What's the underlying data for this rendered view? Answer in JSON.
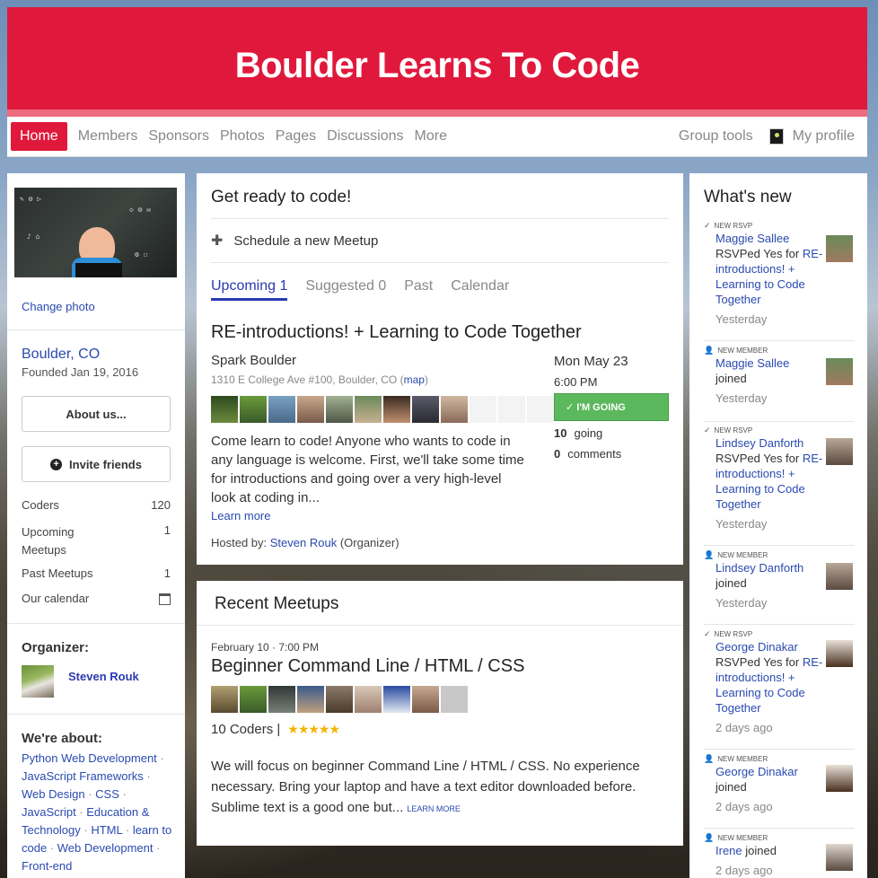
{
  "group_name": "Boulder Learns To Code",
  "nav": {
    "home": "Home",
    "members": "Members",
    "sponsors": "Sponsors",
    "photos": "Photos",
    "pages": "Pages",
    "discussions": "Discussions",
    "more": "More",
    "group_tools": "Group tools",
    "my_profile": "My profile"
  },
  "sidebar": {
    "change_photo": "Change photo",
    "location": "Boulder, CO",
    "founded": "Founded Jan 19, 2016",
    "about_button": "About us...",
    "invite_button": "Invite friends",
    "stats": [
      {
        "label": "Coders",
        "value": "120"
      },
      {
        "label": "Upcoming Meetups",
        "value": "1"
      },
      {
        "label": "Past Meetups",
        "value": "1"
      },
      {
        "label": "Our calendar",
        "value": ""
      }
    ],
    "organizer_label": "Organizer:",
    "organizer_name": "Steven Rouk",
    "about_label": "We're about:",
    "topics": [
      "Python Web Development",
      "JavaScript Frameworks",
      "Web Design",
      "CSS",
      "JavaScript",
      "Education & Technology",
      "HTML",
      "learn to code",
      "Web Development",
      "Front-end"
    ]
  },
  "main": {
    "title": "Get ready to code!",
    "schedule": "Schedule a new Meetup",
    "tabs": [
      "Upcoming 1",
      "Suggested 0",
      "Past",
      "Calendar"
    ],
    "event": {
      "title": "RE-introductions! + Learning to Code Together",
      "venue": "Spark Boulder",
      "address": "1310 E College Ave #100, Boulder, CO (",
      "map_link": "map",
      "address_close": ")",
      "description": "Come learn to code! Anyone who wants to code in any language is welcome. First, we'll take some time for introductions and going over a very high-level look at coding in...",
      "learn_more": "Learn more",
      "hosted_prefix": "Hosted by: ",
      "host": "Steven Rouk",
      "hosted_suffix": " (Organizer)",
      "date": "Mon May 23",
      "time": "6:00 PM",
      "going_button": "✓ I'M GOING",
      "going_count": "10",
      "going_label": "going",
      "comment_count": "0",
      "comment_label": "comments"
    }
  },
  "recent": {
    "title": "Recent Meetups",
    "date": "February 10 · 7:00 PM",
    "event_title": "Beginner Command Line / HTML / CSS",
    "coders": "10 Coders |",
    "stars": "★★★★★",
    "description": "We will focus on beginner Command Line / HTML / CSS. No experience necessary. Bring your laptop and have a text editor downloaded before. Sublime text is a good one but...",
    "learn_more": "LEARN MORE"
  },
  "whats_new": {
    "title": "What's new",
    "items": [
      {
        "kind": "NEW RSVP",
        "name": "Maggie Sallee",
        "text": " RSVPed Yes for ",
        "link": "RE-introductions! + Learning to Code Together",
        "time": "Yesterday"
      },
      {
        "kind": "NEW MEMBER",
        "name": "Maggie Sallee",
        "text": " joined",
        "link": "",
        "time": "Yesterday"
      },
      {
        "kind": "NEW RSVP",
        "name": "Lindsey Danforth",
        "text": " RSVPed Yes for ",
        "link": "RE-introductions! + Learning to Code Together",
        "time": "Yesterday"
      },
      {
        "kind": "NEW MEMBER",
        "name": "Lindsey Danforth",
        "text": " joined",
        "link": "",
        "time": "Yesterday"
      },
      {
        "kind": "NEW RSVP",
        "name": "George Dinakar",
        "text": " RSVPed Yes for ",
        "link": "RE-introductions! + Learning to Code Together",
        "time": "2 days ago"
      },
      {
        "kind": "NEW MEMBER",
        "name": "George Dinakar",
        "text": " joined",
        "link": "",
        "time": "2 days ago"
      },
      {
        "kind": "NEW MEMBER",
        "name": "Irene",
        "text": " joined",
        "link": "",
        "time": "2 days ago"
      }
    ]
  },
  "colors": {
    "brand": "#e0193c",
    "link": "#2a4ab0",
    "going": "#5cb85c"
  }
}
